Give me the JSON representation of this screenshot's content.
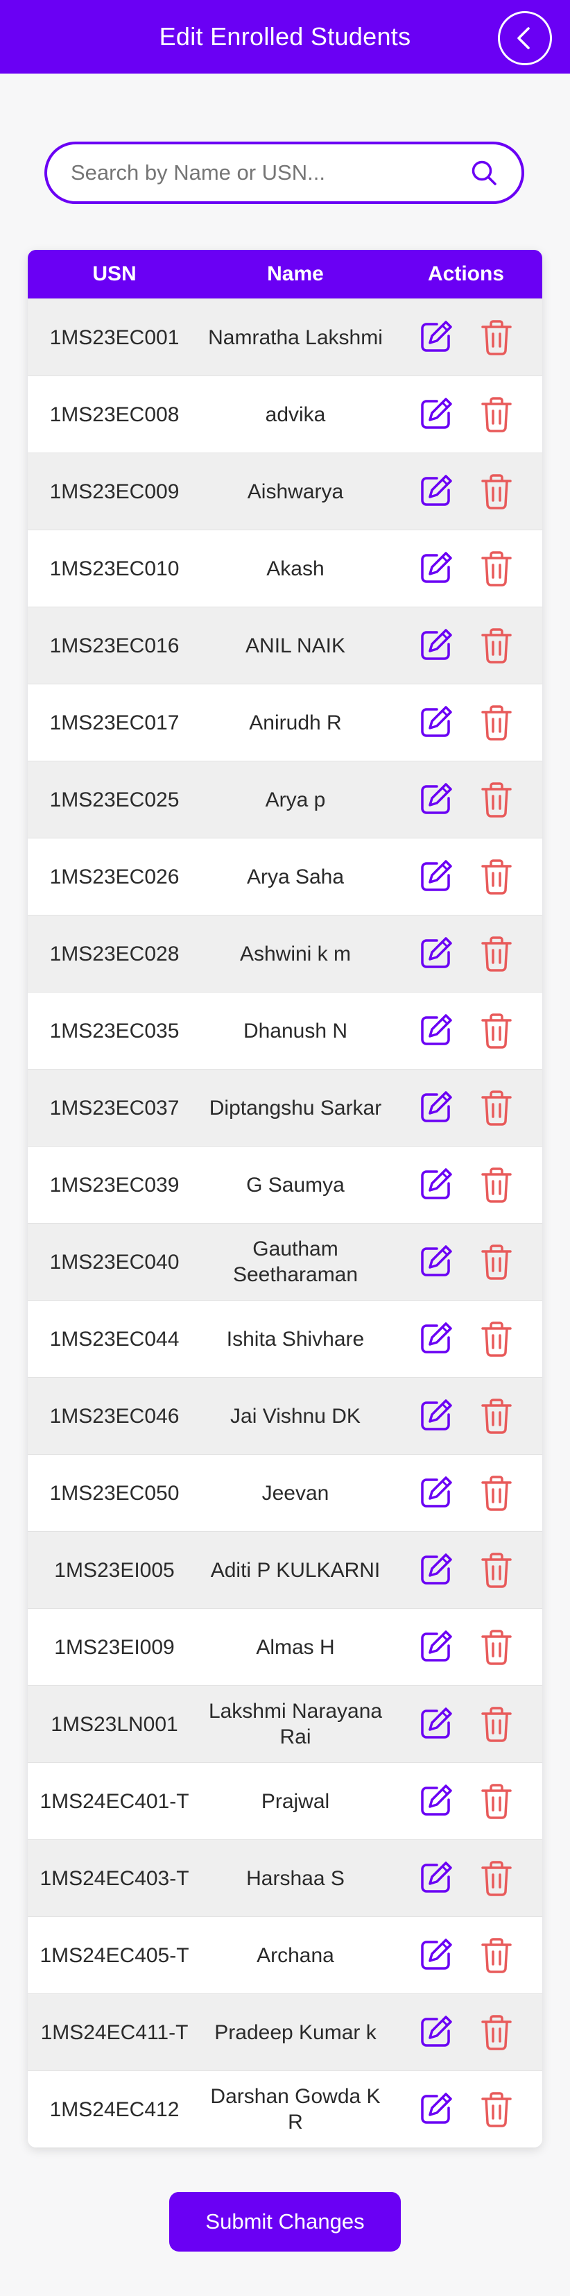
{
  "header": {
    "title": "Edit Enrolled Students",
    "back_icon": "chevron-left-icon"
  },
  "search": {
    "placeholder": "Search by Name or USN...",
    "value": "",
    "icon": "search-icon"
  },
  "table": {
    "columns": [
      "USN",
      "Name",
      "Actions"
    ],
    "rows": [
      {
        "usn": "1MS23EC001",
        "name": "Namratha Lakshmi"
      },
      {
        "usn": "1MS23EC008",
        "name": "advika"
      },
      {
        "usn": "1MS23EC009",
        "name": "Aishwarya"
      },
      {
        "usn": "1MS23EC010",
        "name": "Akash"
      },
      {
        "usn": "1MS23EC016",
        "name": "ANIL NAIK"
      },
      {
        "usn": "1MS23EC017",
        "name": "Anirudh R"
      },
      {
        "usn": "1MS23EC025",
        "name": "Arya p"
      },
      {
        "usn": "1MS23EC026",
        "name": "Arya Saha"
      },
      {
        "usn": "1MS23EC028",
        "name": "Ashwini k m"
      },
      {
        "usn": "1MS23EC035",
        "name": "Dhanush N"
      },
      {
        "usn": "1MS23EC037",
        "name": "Diptangshu Sarkar"
      },
      {
        "usn": "1MS23EC039",
        "name": "G Saumya"
      },
      {
        "usn": "1MS23EC040",
        "name": "Gautham Seetharaman"
      },
      {
        "usn": "1MS23EC044",
        "name": "Ishita Shivhare"
      },
      {
        "usn": "1MS23EC046",
        "name": "Jai Vishnu DK"
      },
      {
        "usn": "1MS23EC050",
        "name": "Jeevan"
      },
      {
        "usn": "1MS23EI005",
        "name": "Aditi P KULKARNI"
      },
      {
        "usn": "1MS23EI009",
        "name": "Almas H"
      },
      {
        "usn": "1MS23LN001",
        "name": "Lakshmi Narayana Rai"
      },
      {
        "usn": "1MS24EC401-T",
        "name": "Prajwal"
      },
      {
        "usn": "1MS24EC403-T",
        "name": "Harshaa S"
      },
      {
        "usn": "1MS24EC405-T",
        "name": "Archana"
      },
      {
        "usn": "1MS24EC411-T",
        "name": "Pradeep Kumar k"
      },
      {
        "usn": "1MS24EC412",
        "name": "Darshan Gowda K R"
      }
    ],
    "action_icons": {
      "edit": "edit-icon",
      "delete": "trash-icon"
    }
  },
  "submit": {
    "label": "Submit Changes"
  },
  "colors": {
    "accent": "#6a00f4",
    "edit_icon": "#6a00f4",
    "delete_icon": "#e85a5a",
    "row_alt": "#efefef",
    "background": "#f7f7f8"
  }
}
